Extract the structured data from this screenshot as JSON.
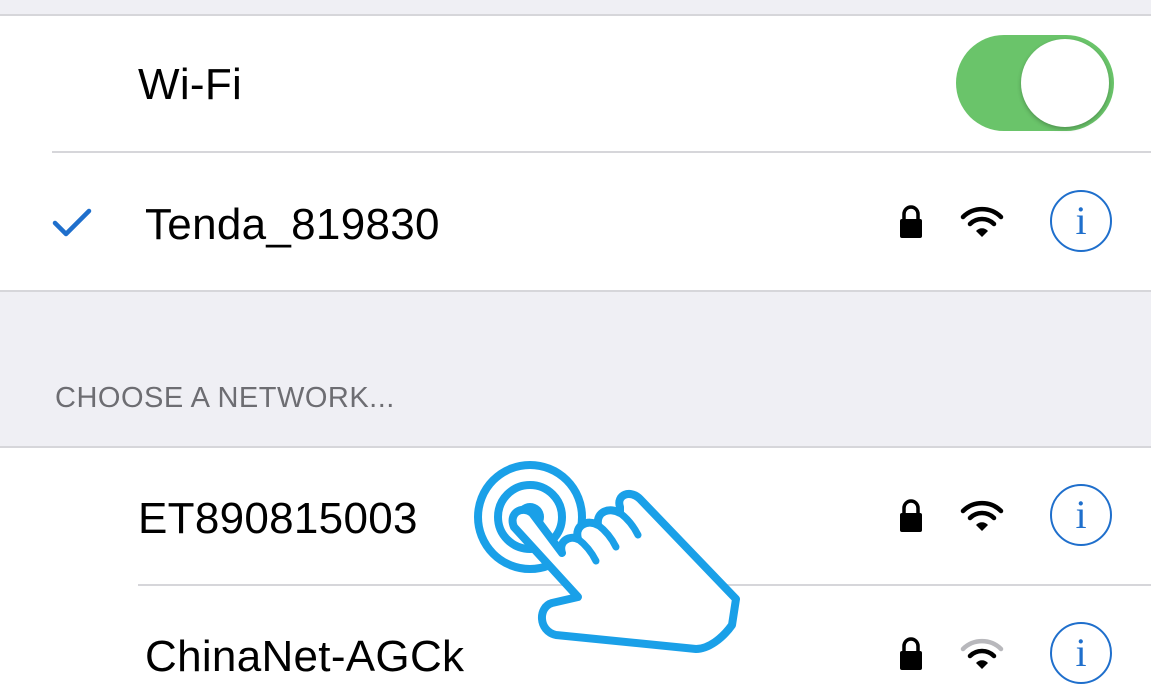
{
  "wifi": {
    "label": "Wi-Fi",
    "enabled": true,
    "toggle_color": "#6ac46a"
  },
  "connected": {
    "ssid": "Tenda_819830",
    "secured": true,
    "signal": "full",
    "info_label": "i"
  },
  "section": {
    "header": "CHOOSE A NETWORK..."
  },
  "networks": [
    {
      "ssid": "ET890815003",
      "secured": true,
      "signal": "full",
      "info_label": "i"
    },
    {
      "ssid": "ChinaNet-AGCk",
      "secured": true,
      "signal": "weak",
      "info_label": "i"
    }
  ],
  "overlay": {
    "icon": "tap-hand-icon",
    "color": "#1aa0e8"
  },
  "colors": {
    "accent": "#1f6fcc",
    "group_background": "#efeff4",
    "separator": "#d6d6da",
    "section_text": "#6d6d72"
  }
}
